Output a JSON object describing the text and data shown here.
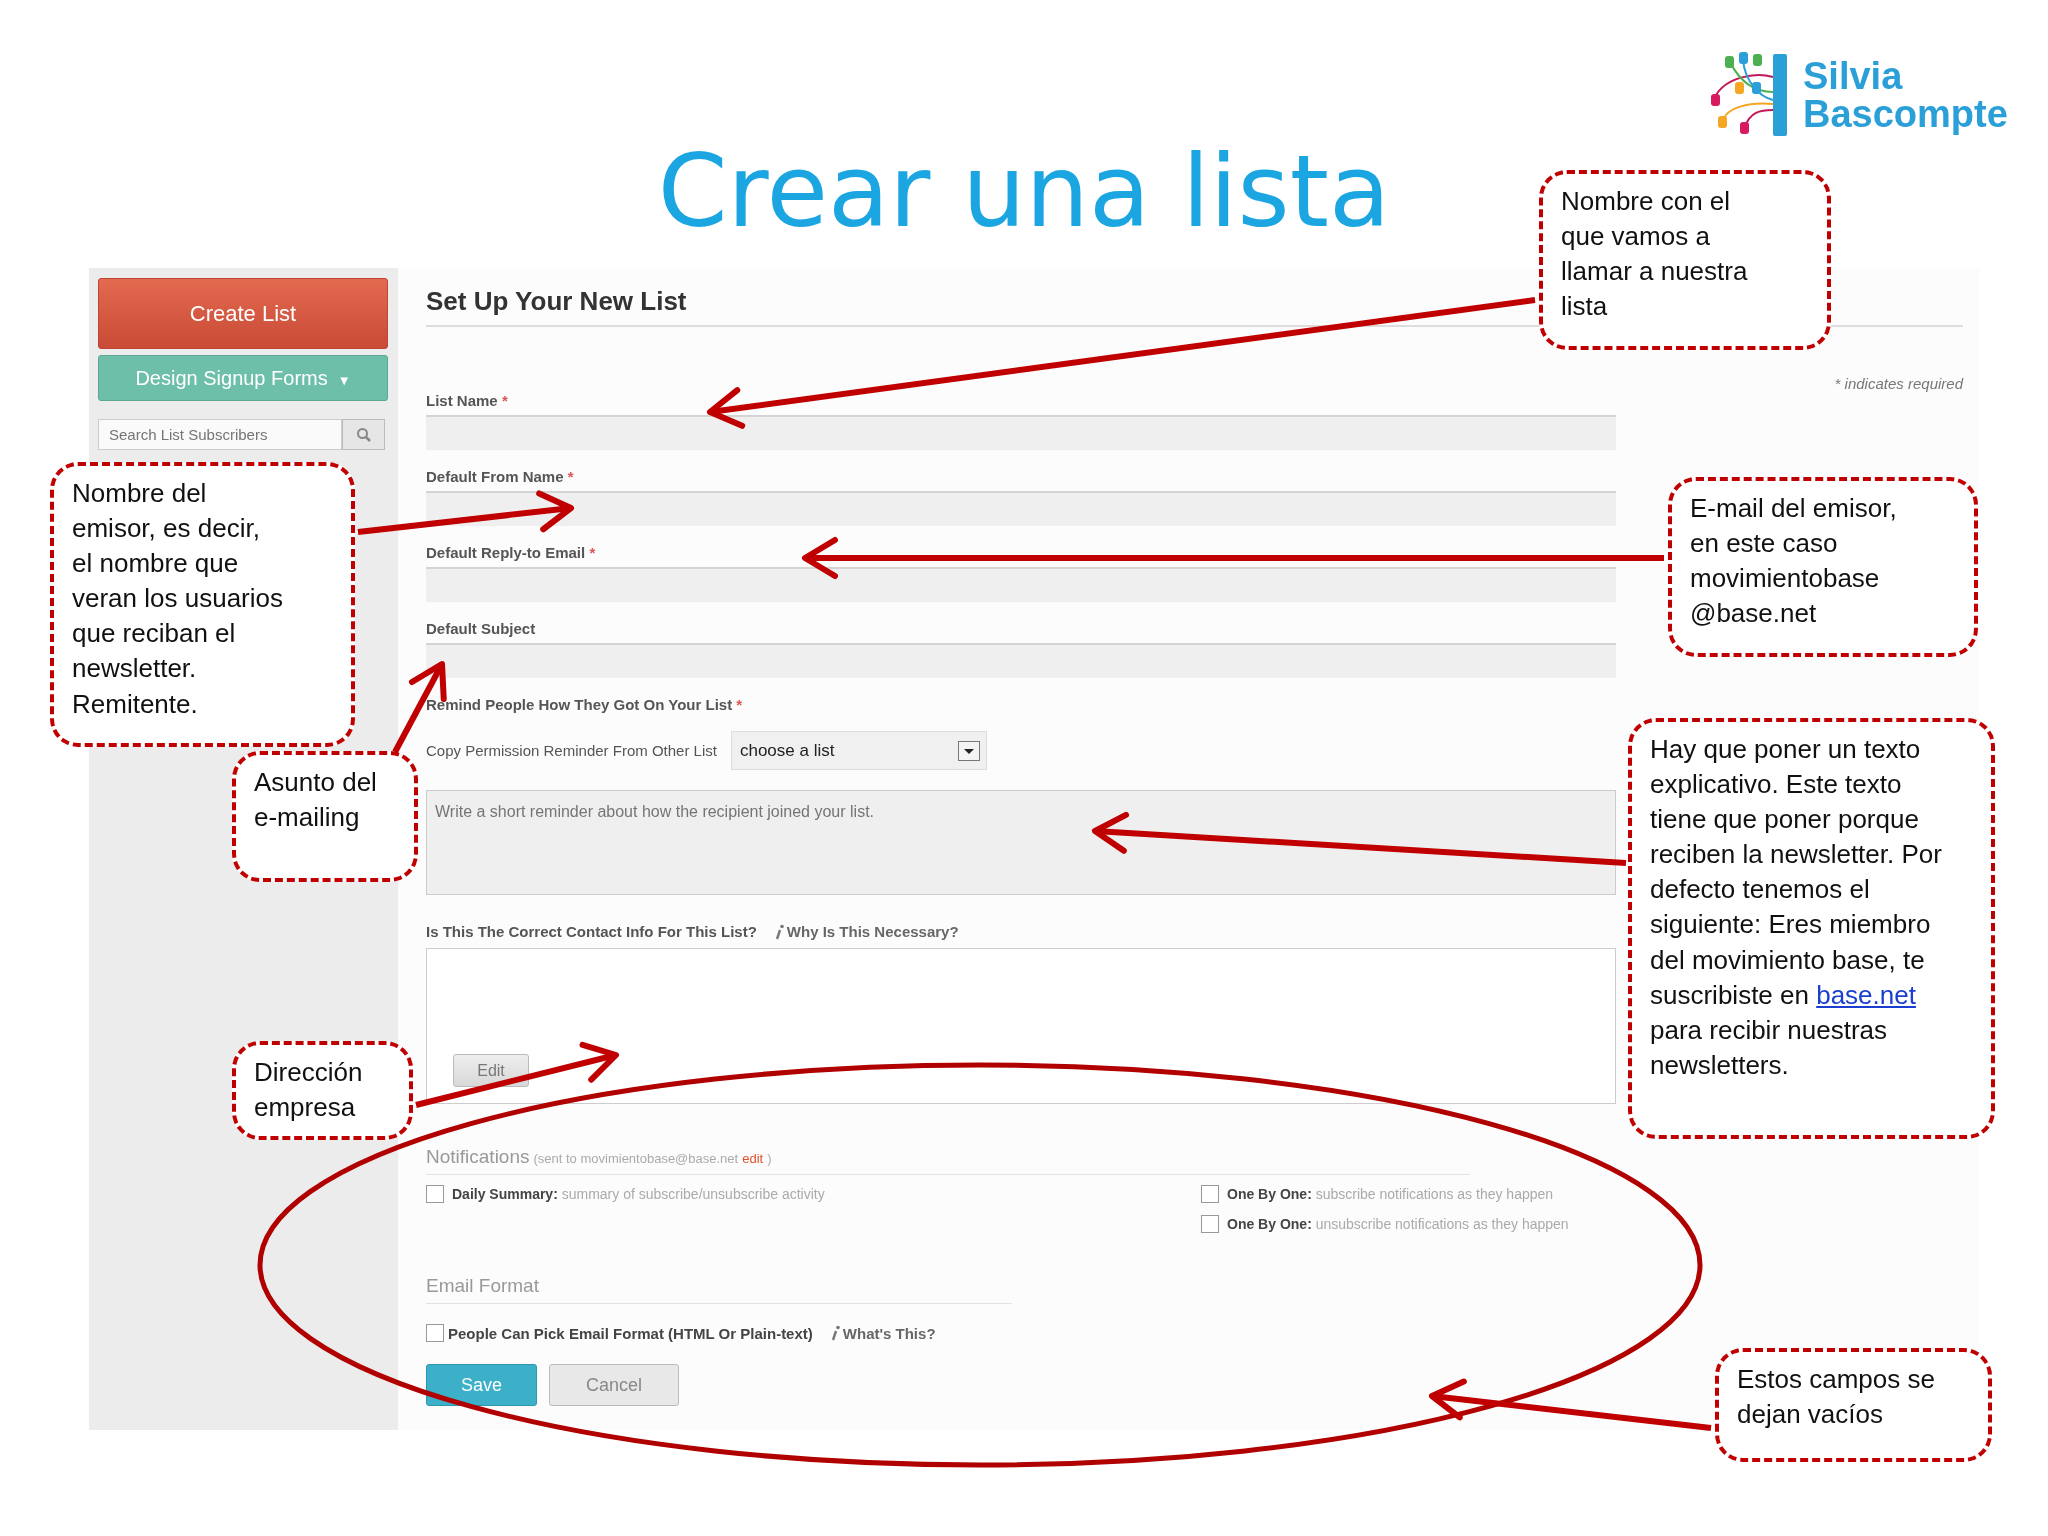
{
  "logo": {
    "line1": "Silvia",
    "line2": "Bascompte"
  },
  "title": "Crear una lista",
  "sidebar": {
    "buttons": [
      {
        "label": "Create List",
        "kind": "primary"
      },
      {
        "label": "Design Signup Forms",
        "kind": "dropdown",
        "caret": "▼"
      }
    ],
    "search": {
      "placeholder": "Search List Subscribers"
    }
  },
  "form": {
    "heading": "Set Up Your New List",
    "required_note": "* indicates required",
    "fields": [
      {
        "label": "List Name",
        "required_mark": "*"
      },
      {
        "label": "Default From Name",
        "required_mark": "*"
      },
      {
        "label": "Default Reply-to Email",
        "required_mark": "*"
      },
      {
        "label": "Default Subject"
      }
    ],
    "remind": {
      "label": "Remind People How They Got On Your List",
      "required_mark": "*",
      "copy_label": "Copy Permission Reminder From Other List",
      "select_value": "choose a list",
      "placeholder": "Write a short reminder about how the recipient joined your list."
    },
    "contact": {
      "label": "Is This The Correct Contact Info For This List?",
      "help": "Why Is This Necessary?",
      "edit_button": "Edit"
    },
    "notifications": {
      "heading": "Notifications",
      "note_prefix": "(sent to movimientobase@base.net",
      "edit_link": "edit",
      "note_suffix": ")",
      "left": [
        {
          "title": "Daily Summary:",
          "text": "summary of subscribe/unsubscribe activity",
          "checked": false
        }
      ],
      "right": [
        {
          "title": "One By One:",
          "text": "subscribe notifications as they happen",
          "checked": false
        },
        {
          "title": "One By One:",
          "text": "unsubscribe notifications as they happen",
          "checked": false
        }
      ]
    },
    "email_format": {
      "heading": "Email Format",
      "option": {
        "label": "People Can Pick Email Format (HTML Or Plain-text)",
        "checked": false
      },
      "help": "What's This?"
    },
    "actions": [
      {
        "label": "Save",
        "kind": "primary"
      },
      {
        "label": "Cancel",
        "kind": "secondary"
      }
    ]
  },
  "callouts": [
    {
      "lines": [
        "Nombre con el",
        "que vamos a",
        "llamar a nuestra",
        "lista"
      ]
    },
    {
      "lines": [
        "Nombre del",
        "emisor, es decir,",
        "el nombre que",
        "veran los usuarios",
        "que reciban el",
        "newsletter.",
        "Remitente."
      ]
    },
    {
      "lines": [
        "E-mail del emisor,",
        "en este caso",
        "movimientobase",
        "@base.net"
      ]
    },
    {
      "lines": [
        "Asunto del",
        "e-mailing"
      ]
    },
    {
      "lines": [
        "Hay que poner un texto",
        "explicativo. Este texto",
        "tiene que poner porque",
        "reciben la newsletter. Por",
        "defecto tenemos el",
        "siguiente: Eres miembro",
        "del movimiento base, te",
        "suscribiste en"
      ],
      "link": "base.net",
      "after": [
        "para recibir nuestras",
        "newsletters."
      ]
    },
    {
      "lines": [
        "Dirección",
        "empresa"
      ]
    },
    {
      "lines": [
        "Estos campos se",
        "dejan vacíos"
      ]
    }
  ]
}
